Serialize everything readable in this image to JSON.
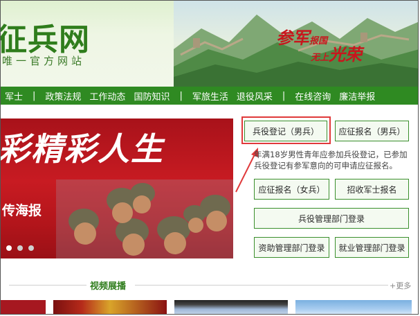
{
  "header": {
    "site_title": "征兵网",
    "site_subtitle": "唯一官方网站",
    "slogan_line1_big": "参军",
    "slogan_line1_small": "报国",
    "slogan_line2_small": "无上",
    "slogan_line2_big": "光荣"
  },
  "nav": {
    "items": [
      "军士",
      "政策法规",
      "工作动态",
      "国防知识",
      "军旅生活",
      "退役风采",
      "在线咨询",
      "廉洁举报"
    ],
    "separator": "|"
  },
  "hero": {
    "headline": "彩精彩人生",
    "poster_label": "传海报",
    "slide_count": 3,
    "active_slide": 1
  },
  "actions": {
    "register_male": "兵役登记（男兵）",
    "apply_male": "应征报名（男兵）",
    "notice": "年满18岁男性青年应参加兵役登记，已参加兵役登记有参军意向的可申请应征报名。",
    "apply_female": "应征报名（女兵）",
    "recruit_nco": "招收军士报名",
    "military_dept_login": "兵役管理部门登录",
    "funding_dept_login": "资助管理部门登录",
    "employment_dept_login": "就业管理部门登录"
  },
  "video": {
    "title": "视频展播",
    "more": "+更多"
  },
  "colors": {
    "brand_green": "#2f8a22",
    "highlight_red": "#e0393a",
    "hero_red": "#c81b22"
  }
}
